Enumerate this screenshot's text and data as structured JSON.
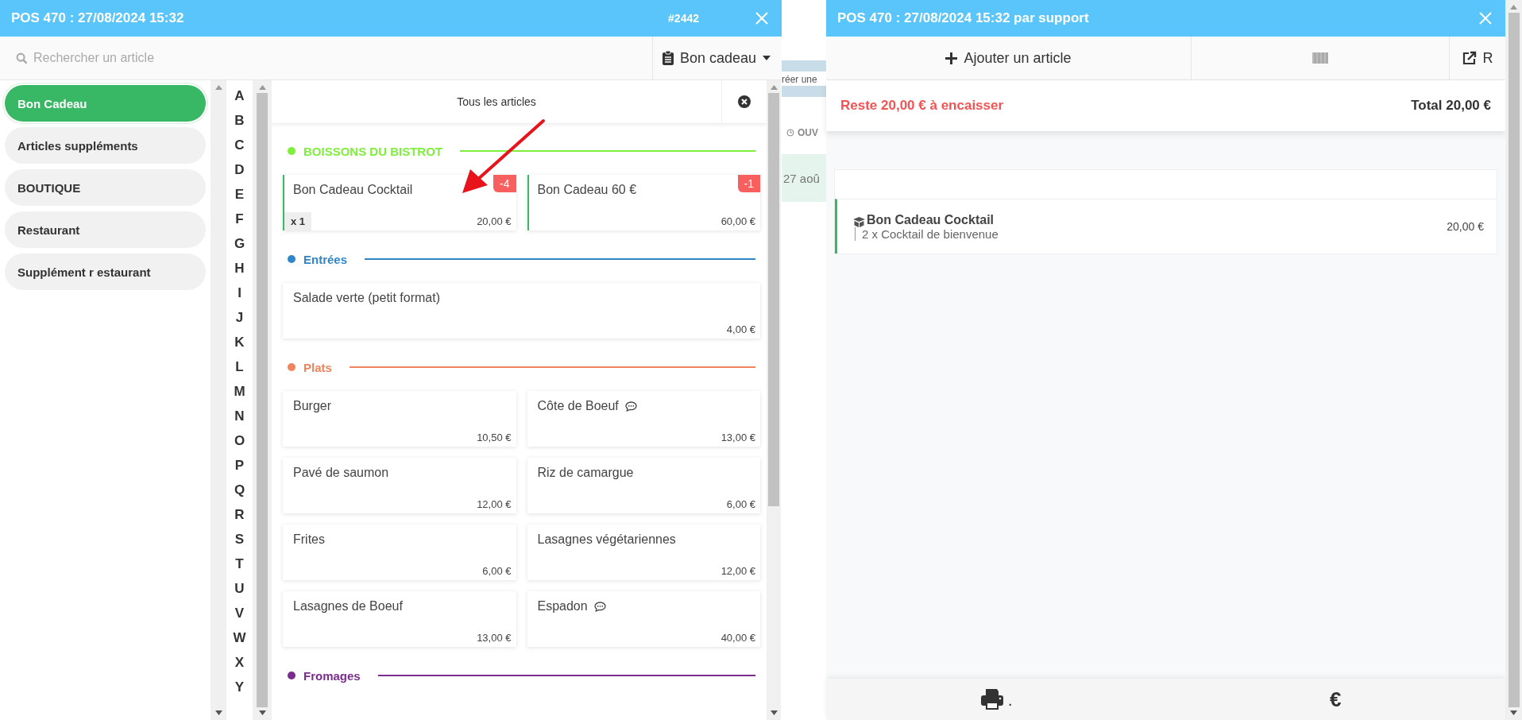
{
  "left_window": {
    "title": "POS 470 : 27/08/2024 15:32",
    "order_number": "#2442",
    "search": {
      "placeholder": "Rechercher un article"
    },
    "menu_select": {
      "value": "Bon cadeau"
    },
    "categories": [
      {
        "label": "Bon Cadeau",
        "selected": true
      },
      {
        "label": "Articles suppléments",
        "selected": false
      },
      {
        "label": "BOUTIQUE",
        "selected": false
      },
      {
        "label": "Restaurant",
        "selected": false
      },
      {
        "label": "Supplément r estaurant",
        "selected": false
      }
    ],
    "alphabet": [
      "A",
      "B",
      "C",
      "D",
      "E",
      "F",
      "G",
      "H",
      "I",
      "J",
      "K",
      "L",
      "M",
      "N",
      "O",
      "P",
      "Q",
      "R",
      "S",
      "T",
      "U",
      "V",
      "W",
      "X",
      "Y"
    ],
    "filter_tab": "Tous les articles",
    "sections": [
      {
        "title": "BOISSONS DU BISTROT",
        "color": "#7ef03c",
        "items": [
          {
            "name": "Bon Cadeau Cocktail",
            "price": "20,00 €",
            "badge": "-4",
            "quantity": "x 1",
            "highlighted": true,
            "has_note": false
          },
          {
            "name": "Bon Cadeau 60 €",
            "price": "60,00 €",
            "badge": "-1",
            "highlighted": true,
            "has_note": false
          }
        ]
      },
      {
        "title": "Entrées",
        "color": "#2f86c8",
        "items": [
          {
            "name": "Salade verte (petit format)",
            "price": "4,00 €",
            "highlighted": false,
            "has_note": false
          }
        ]
      },
      {
        "title": "Plats",
        "color": "#f0845c",
        "items": [
          {
            "name": "Burger",
            "price": "10,50 €",
            "highlighted": false,
            "has_note": false
          },
          {
            "name": "Côte de Boeuf",
            "price": "13,00 €",
            "highlighted": false,
            "has_note": true
          },
          {
            "name": "Pavé de saumon",
            "price": "12,00 €",
            "highlighted": false,
            "has_note": false
          },
          {
            "name": "Riz de camargue",
            "price": "6,00 €",
            "highlighted": false,
            "has_note": false
          },
          {
            "name": "Frites",
            "price": "6,00 €",
            "highlighted": false,
            "has_note": false
          },
          {
            "name": "Lasagnes végétariennes",
            "price": "12,00 €",
            "highlighted": false,
            "has_note": false
          },
          {
            "name": "Lasagnes de Boeuf",
            "price": "13,00 €",
            "highlighted": false,
            "has_note": false
          },
          {
            "name": "Espadon",
            "price": "40,00 €",
            "highlighted": false,
            "has_note": true
          }
        ]
      },
      {
        "title": "Fromages",
        "color": "#7b2d8e"
      }
    ]
  },
  "background_page": {
    "button_text": "réer une",
    "column_heading": "OUV",
    "date_text": "27 aoû"
  },
  "right_window": {
    "title": "POS 470 : 27/08/2024 15:32 par support",
    "add_button": "Ajouter un article",
    "external_button": "R",
    "remaining": "Reste 20,00 € à encaisser",
    "total": "Total 20,00 €",
    "lines": [
      {
        "name": "Bon Cadeau Cocktail",
        "detail": "2 x Cocktail de bienvenue",
        "price": "20,00 €"
      }
    ],
    "footer": {
      "print_suffix": ".",
      "pay_label": "€"
    }
  }
}
